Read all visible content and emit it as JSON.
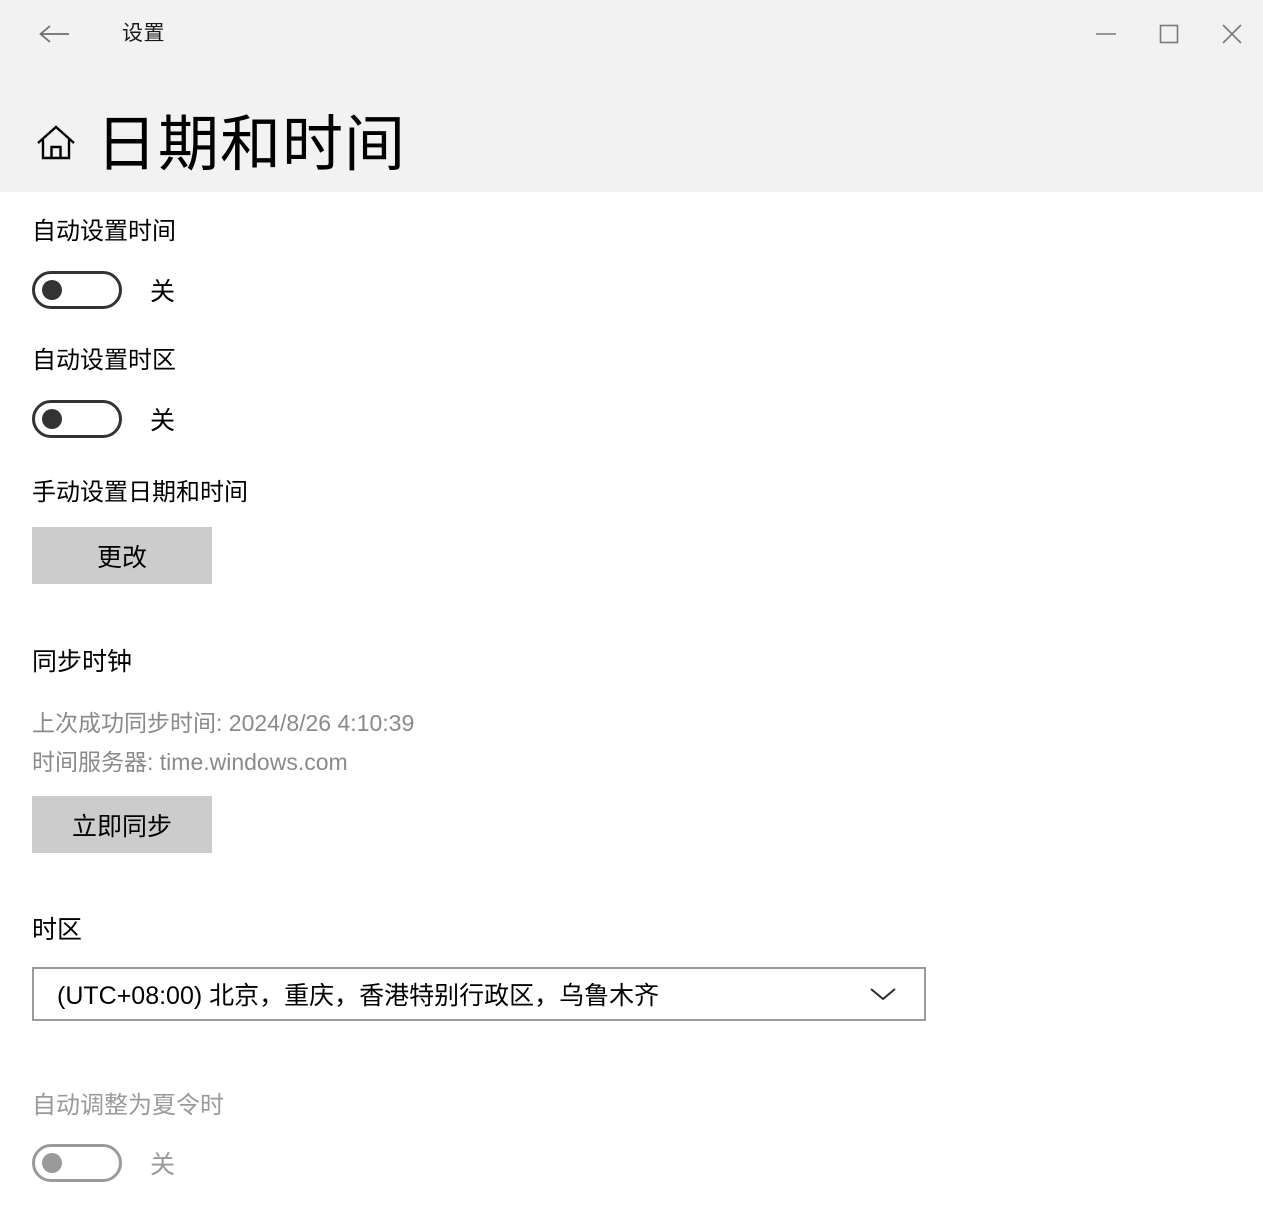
{
  "window": {
    "app_title": "设置",
    "back_icon": "back-arrow-icon",
    "minimize_label": "minimize-icon",
    "maximize_label": "maximize-icon",
    "close_label": "close-icon"
  },
  "page": {
    "home_icon": "home-icon",
    "title": "日期和时间"
  },
  "settings": {
    "auto_time": {
      "label": "自动设置时间",
      "state": "关",
      "enabled": true
    },
    "auto_timezone": {
      "label": "自动设置时区",
      "state": "关",
      "enabled": true
    },
    "manual_datetime": {
      "label": "手动设置日期和时间",
      "button": "更改"
    },
    "sync_clock": {
      "heading": "同步时钟",
      "last_sync": "上次成功同步时间: 2024/8/26 4:10:39",
      "server": "时间服务器: time.windows.com",
      "button": "立即同步"
    },
    "timezone": {
      "label": "时区",
      "selected": "(UTC+08:00) 北京，重庆，香港特别行政区，乌鲁木齐",
      "chevron_icon": "chevron-down-icon"
    },
    "dst": {
      "label": "自动调整为夏令时",
      "state": "关",
      "enabled": false
    }
  },
  "colors": {
    "header_bg": "#f2f2f2",
    "page_bg": "#ffffff",
    "button_bg": "#cccccc",
    "text": "#000000",
    "muted_text": "#8a8a8a",
    "disabled": "#9a9a9a"
  }
}
